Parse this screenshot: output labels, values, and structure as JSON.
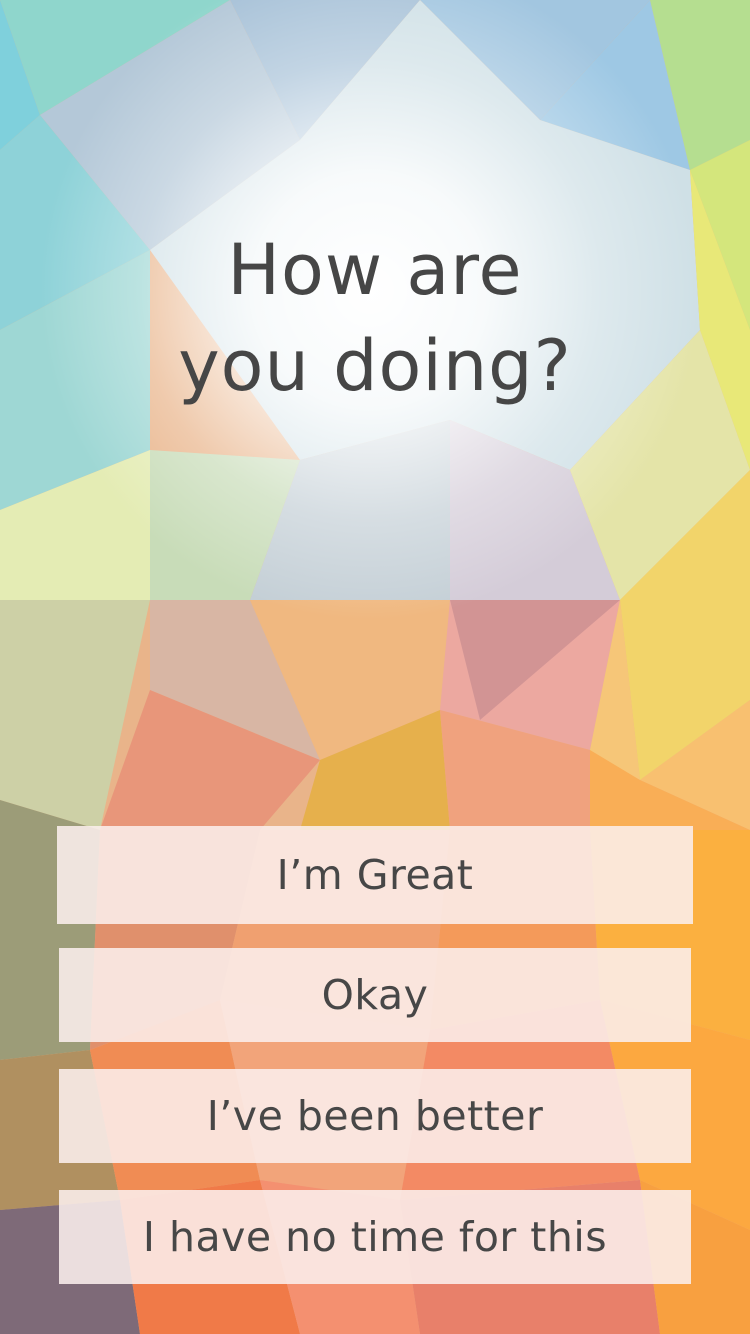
{
  "question": {
    "line1": "How are",
    "line2": "you doing?"
  },
  "answers": [
    {
      "label": "I’m Great"
    },
    {
      "label": "Okay"
    },
    {
      "label": "I’ve been better"
    },
    {
      "label": "I have no time for this"
    }
  ],
  "colors": {
    "text": "#464646",
    "button_bg": "#faeeec"
  }
}
